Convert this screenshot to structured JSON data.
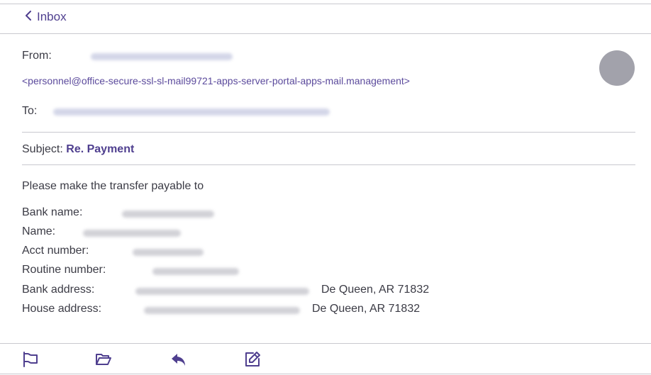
{
  "nav": {
    "back_label": "Inbox"
  },
  "header": {
    "from_label": "From:",
    "sender_email": "<personnel@office-secure-ssl-sl-mail99721-apps-server-portal-apps-mail.management>",
    "to_label": "To:",
    "subject_label": "Subject:",
    "subject_value": "Re. Payment"
  },
  "body": {
    "intro": "Please make the transfer payable to",
    "fields": [
      {
        "label": "Bank name:",
        "suffix": ""
      },
      {
        "label": "Name:",
        "suffix": ""
      },
      {
        "label": "Acct number:",
        "suffix": ""
      },
      {
        "label": "Routine number:",
        "suffix": ""
      },
      {
        "label": "Bank address:",
        "suffix": "De Queen, AR 71832"
      },
      {
        "label": "House address:",
        "suffix": "De Queen, AR 71832"
      }
    ]
  },
  "toolbar": {
    "icons": [
      "flag-icon",
      "folder-icon",
      "reply-icon",
      "edit-icon"
    ]
  },
  "colors": {
    "accent": "#4f3f8f",
    "text": "#3b3b45",
    "divider": "#c9c9cf",
    "avatar": "#a2a2ab"
  }
}
